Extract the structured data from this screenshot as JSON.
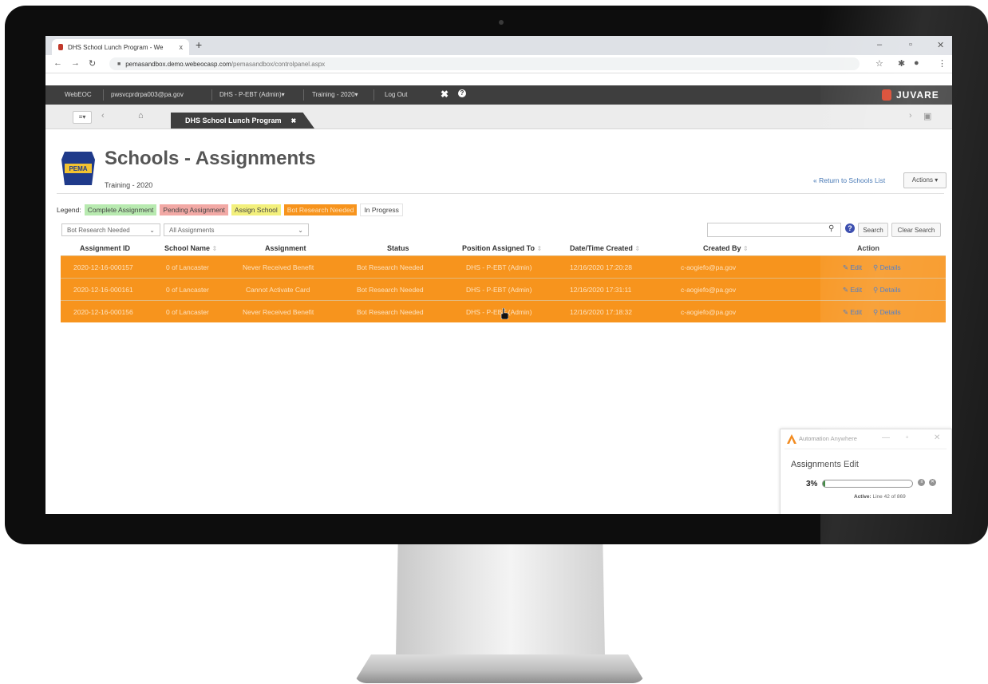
{
  "browser": {
    "tab_title": "DHS School Lunch Program - We",
    "tab_close": "x",
    "new_tab": "+",
    "url_host": "pemasandbox.demo.webeocasp.com",
    "url_path": "/pemasandbox/controlpanel.aspx",
    "win_minimize": "–",
    "win_restore": "▫",
    "win_close": "✕"
  },
  "appbar": {
    "app_name": "WebEOC",
    "user": "pwsvcprdrpa003@pa.gov",
    "position": "DHS - P-EBT (Admin)▾",
    "incident": "Training - 2020▾",
    "logout": "Log Out",
    "brand": "JUVARE"
  },
  "control_tabs": {
    "active_tab": "DHS School Lunch Program",
    "tab_close": "✖"
  },
  "page": {
    "logo_text": "PEMA",
    "title": "Schools - Assignments",
    "subtitle": "Training - 2020",
    "return_link": "« Return to Schools List",
    "actions_button": "Actions ▾"
  },
  "legend": {
    "label": "Legend:",
    "items": [
      {
        "label": "Complete Assignment",
        "color": "#b8eab0"
      },
      {
        "label": "Pending Assignment",
        "color": "#f2a9a5"
      },
      {
        "label": "Assign School",
        "color": "#f3f07c"
      },
      {
        "label": "Bot Research Needed",
        "color": "#f7941d"
      },
      {
        "label": "In Progress",
        "color": "#ffffff"
      }
    ]
  },
  "filters": {
    "status_select": "Bot Research Needed",
    "assignment_select": "All Assignments",
    "search_value": "",
    "search_button": "Search",
    "clear_button": "Clear Search"
  },
  "table": {
    "columns": [
      "Assignment ID",
      "School Name",
      "Assignment",
      "Status",
      "Position Assigned To",
      "Date/Time Created",
      "Created By",
      "Action"
    ],
    "sort_glyph": "⇕",
    "edit_label": "Edit",
    "details_label": "Details",
    "rows": [
      {
        "id": "2020-12-16-000157",
        "school": "0 of Lancaster",
        "assignment": "Never Received Benefit",
        "status": "Bot Research Needed",
        "position": "DHS - P-EBT (Admin)",
        "created": "12/16/2020 17:20:28",
        "created_by": "c-aogiefo@pa.gov"
      },
      {
        "id": "2020-12-16-000161",
        "school": "0 of Lancaster",
        "assignment": "Cannot Activate Card",
        "status": "Bot Research Needed",
        "position": "DHS - P-EBT (Admin)",
        "created": "12/16/2020 17:31:11",
        "created_by": "c-aogiefo@pa.gov"
      },
      {
        "id": "2020-12-16-000156",
        "school": "0 of Lancaster",
        "assignment": "Never Received Benefit",
        "status": "Bot Research Needed",
        "position": "DHS - P-EBT (Admin)",
        "created": "12/16/2020 17:18:32",
        "created_by": "c-aogiefo@pa.gov"
      }
    ]
  },
  "automation_panel": {
    "brand": "Automation Anywhere",
    "minimize": "—",
    "maximize": "▫",
    "close": "✕",
    "task_name": "Assignments Edit",
    "progress_text": "3%",
    "progress": 0.03,
    "status_label": "Active:",
    "status_value": "Line 42 of 869"
  },
  "colors": {
    "row_highlight": "#f7941d",
    "appbar_bg": "#3e3e3e",
    "accent_orange": "#d8432a"
  }
}
